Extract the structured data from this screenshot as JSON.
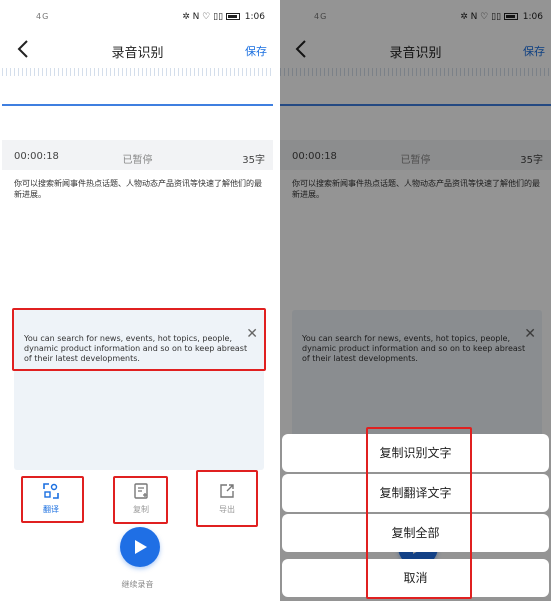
{
  "status": {
    "time": "1:06",
    "network": "4G",
    "icons": "✲ N ♡ ▯▯"
  },
  "nav": {
    "title": "录音识别",
    "save": "保存"
  },
  "recording": {
    "elapsed": "00:00:18",
    "state": "已暂停",
    "char_count": "35字"
  },
  "transcript": "你可以搜索新闻事件热点话题、人物动态产品资讯等快速了解他们的最新进展。",
  "translation": "You can search for news, events, hot topics, people, dynamic product information and so on to keep abreast of their latest developments.",
  "toolbar": {
    "translate": "翻译",
    "copy": "复制",
    "export": "导出"
  },
  "continue_recording": "继续录音",
  "action_sheet": {
    "copy_recognized": "复制识别文字",
    "copy_translated": "复制翻译文字",
    "copy_all": "复制全部",
    "cancel": "取消"
  },
  "colors": {
    "accent": "#1a6fe0",
    "highlight": "#e02020",
    "panel": "#eef3f8"
  },
  "icons": [
    "back-icon",
    "translate-icon",
    "copy-icon",
    "export-icon",
    "play-icon",
    "close-icon",
    "battery-icon"
  ]
}
